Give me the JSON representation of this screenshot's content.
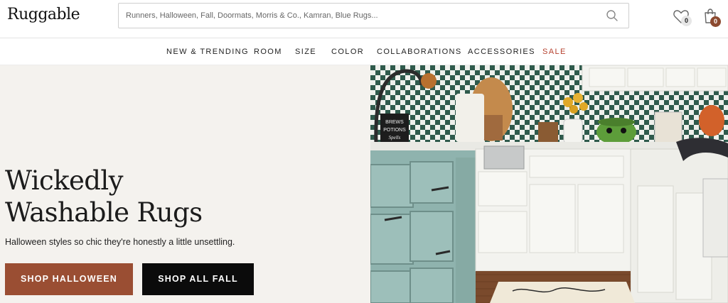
{
  "header": {
    "logo": "Ruggable",
    "search_placeholder": "Runners, Halloween, Fall, Doormats, Morris & Co., Kamran, Blue Rugs...",
    "wishlist_count": "0",
    "cart_count": "0"
  },
  "nav": {
    "items": [
      "NEW & TRENDING",
      "ROOM",
      "SIZE",
      "COLOR",
      "COLLABORATIONS",
      "ACCESSORIES",
      "SALE"
    ]
  },
  "hero": {
    "headline_line1": "Wickedly",
    "headline_line2": "Washable Rugs",
    "subtitle": "Halloween styles so chic they're honestly a little unsettling.",
    "primary_button": "SHOP HALLOWEEN",
    "secondary_button": "SHOP ALL FALL",
    "image": {
      "description_colors": {
        "tile_green": "#2f5a4c",
        "tile_light": "#eef0ec",
        "cabinet_teal": "#8fb3ae",
        "cabinet_white": "#f3f3ef",
        "floor_wood": "#7a4a2c"
      },
      "props": {
        "sign_line1": "BREWS",
        "sign_line2": "POTIONS",
        "sign_line3": "Spells"
      }
    }
  },
  "colors": {
    "accent": "#9a4e33",
    "sale": "#b5402e",
    "dark_button": "#0b0b0b",
    "hero_bg": "#f4f2ee"
  }
}
